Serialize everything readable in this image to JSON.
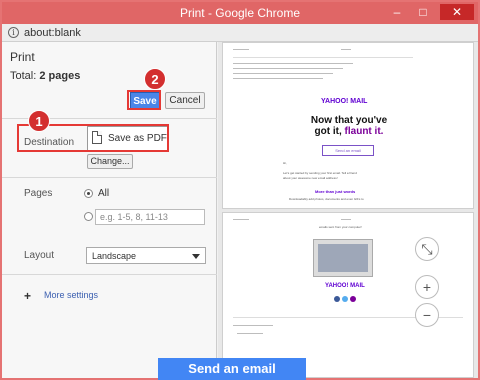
{
  "window": {
    "title": "Print - Google Chrome",
    "minimize": "–",
    "maximize": "□",
    "close": "✕"
  },
  "address": {
    "url": "about:blank",
    "info_icon": "i"
  },
  "print": {
    "title": "Print",
    "total_prefix": "Total: ",
    "total_value": "2 pages",
    "save_label": "Save",
    "cancel_label": "Cancel",
    "destination_label": "Destination",
    "destination_value": "Save as PDF",
    "change_label": "Change...",
    "pages_label": "Pages",
    "pages_all": "All",
    "pages_placeholder": "e.g. 1-5, 8, 11-13",
    "layout_label": "Layout",
    "layout_value": "Landscape",
    "more_settings_plus": "+",
    "more_settings_label": "More settings"
  },
  "callouts": {
    "one": "1",
    "two": "2"
  },
  "preview": {
    "yahoo_mail": "YAHOO! MAIL",
    "headline_1": "Now that you've",
    "headline_2": "got it, ",
    "headline_3": "flaunt it.",
    "send_outline": "Send an email",
    "hi": "Hi,",
    "body_1": "Let's get started by sending your first email. Tell a friend",
    "body_2": "about your awesome new email address!",
    "more_words": "More than just words",
    "body_3": "Downloadably add photos, documents and even GIFs to",
    "page2_top": "emails sent from your computer!",
    "yahoo_mail_2": "YAHOO! MAIL",
    "zoom_fit": "⤡",
    "zoom_in": "+",
    "zoom_out": "−"
  },
  "footer": {
    "send_email": "Send an email"
  }
}
